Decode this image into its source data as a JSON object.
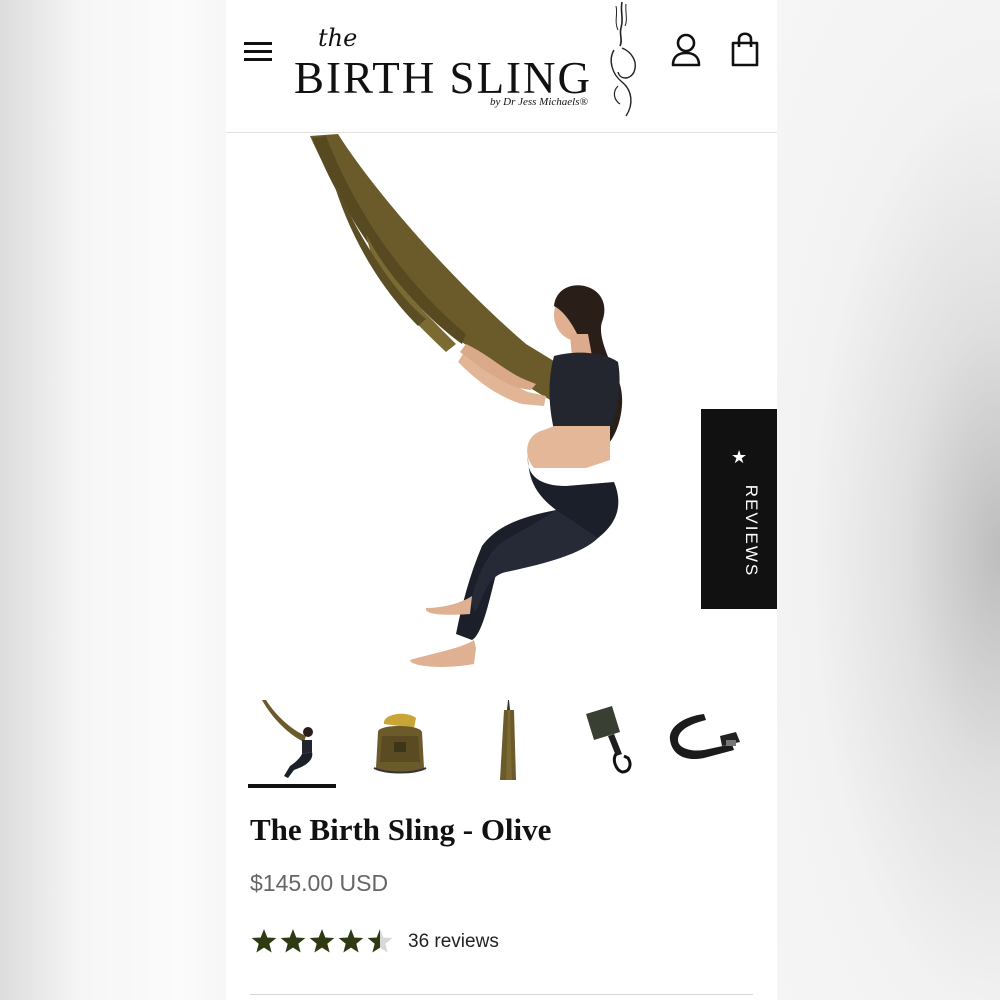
{
  "header": {
    "logo": {
      "the": "the",
      "main": "BIRTH SLING",
      "byline": "by Dr Jess Michaels®"
    },
    "icons": [
      "hamburger-menu-icon",
      "account-icon",
      "shopping-bag-icon"
    ]
  },
  "reviews_tab": {
    "star": "★",
    "label": "REVIEWS"
  },
  "gallery": {
    "thumbnails": [
      {
        "name": "woman-in-sling",
        "selected": true
      },
      {
        "name": "sling-in-bag",
        "selected": false
      },
      {
        "name": "hanging-sling",
        "selected": false
      },
      {
        "name": "door-anchor",
        "selected": false
      },
      {
        "name": "strap",
        "selected": false
      }
    ]
  },
  "product": {
    "title": "The Birth Sling - Olive",
    "price": "$145.00 USD",
    "rating": 4.5,
    "rating_max": 5,
    "reviews": "36 reviews"
  },
  "colors": {
    "olive": "#6b5a2a",
    "star_fill": "#2f3a12",
    "legging": "#1b1f2a"
  }
}
